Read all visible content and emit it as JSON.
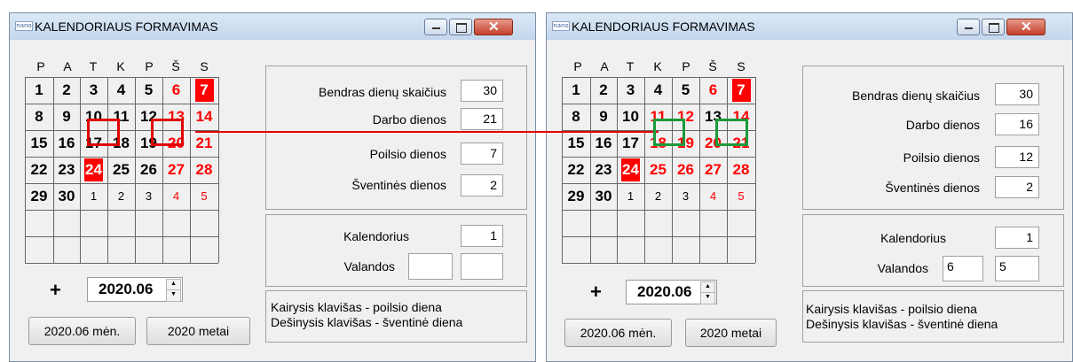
{
  "weekdays": [
    "P",
    "A",
    "T",
    "K",
    "P",
    "Š",
    "S"
  ],
  "left": {
    "title": "KALENDORIAUS FORMAVIMAS",
    "app_icon_text": "nano",
    "days": [
      {
        "t": "1",
        "s": "n"
      },
      {
        "t": "2",
        "s": "n"
      },
      {
        "t": "3",
        "s": "n"
      },
      {
        "t": "4",
        "s": "n"
      },
      {
        "t": "5",
        "s": "n"
      },
      {
        "t": "6",
        "s": "r"
      },
      {
        "t": "7",
        "s": "rb"
      },
      {
        "t": "8",
        "s": "n"
      },
      {
        "t": "9",
        "s": "n"
      },
      {
        "t": "10",
        "s": "n"
      },
      {
        "t": "11",
        "s": "n"
      },
      {
        "t": "12",
        "s": "n"
      },
      {
        "t": "13",
        "s": "r"
      },
      {
        "t": "14",
        "s": "r"
      },
      {
        "t": "15",
        "s": "n"
      },
      {
        "t": "16",
        "s": "n"
      },
      {
        "t": "17",
        "s": "n"
      },
      {
        "t": "18",
        "s": "n"
      },
      {
        "t": "19",
        "s": "n"
      },
      {
        "t": "20",
        "s": "r"
      },
      {
        "t": "21",
        "s": "r"
      },
      {
        "t": "22",
        "s": "n"
      },
      {
        "t": "23",
        "s": "n"
      },
      {
        "t": "24",
        "s": "rb"
      },
      {
        "t": "25",
        "s": "n"
      },
      {
        "t": "26",
        "s": "n"
      },
      {
        "t": "27",
        "s": "r"
      },
      {
        "t": "28",
        "s": "r"
      },
      {
        "t": "29",
        "s": "n"
      },
      {
        "t": "30",
        "s": "n"
      },
      {
        "t": "1",
        "s": "sm"
      },
      {
        "t": "2",
        "s": "sm"
      },
      {
        "t": "3",
        "s": "sm"
      },
      {
        "t": "4",
        "s": "smr"
      },
      {
        "t": "5",
        "s": "smr"
      }
    ],
    "stats": {
      "total_label": "Bendras dienų skaičius",
      "total": "30",
      "work_label": "Darbo dienos",
      "work": "21",
      "rest_label": "Poilsio dienos",
      "rest": "7",
      "holiday_label": "Šventinės dienos",
      "holiday": "2"
    },
    "calendar_label": "Kalendorius",
    "calendar_value": "1",
    "hours_label": "Valandos",
    "hours_a": "",
    "hours_b": "",
    "plus": "+",
    "spinner_value": "2020.06",
    "month_button": "2020.06 mėn.",
    "year_button": "2020 metai",
    "hint_1": "Kairysis klavišas - poilsio diena",
    "hint_2": "Dešinysis klavišas - šventinė diena"
  },
  "right": {
    "title": "KALENDORIAUS FORMAVIMAS",
    "app_icon_text": "nano",
    "days": [
      {
        "t": "1",
        "s": "n"
      },
      {
        "t": "2",
        "s": "n"
      },
      {
        "t": "3",
        "s": "n"
      },
      {
        "t": "4",
        "s": "n"
      },
      {
        "t": "5",
        "s": "n"
      },
      {
        "t": "6",
        "s": "r"
      },
      {
        "t": "7",
        "s": "rb"
      },
      {
        "t": "8",
        "s": "n"
      },
      {
        "t": "9",
        "s": "n"
      },
      {
        "t": "10",
        "s": "n"
      },
      {
        "t": "11",
        "s": "r"
      },
      {
        "t": "12",
        "s": "r"
      },
      {
        "t": "13",
        "s": "n"
      },
      {
        "t": "14",
        "s": "r"
      },
      {
        "t": "15",
        "s": "n"
      },
      {
        "t": "16",
        "s": "n"
      },
      {
        "t": "17",
        "s": "n"
      },
      {
        "t": "18",
        "s": "r"
      },
      {
        "t": "19",
        "s": "r"
      },
      {
        "t": "20",
        "s": "r"
      },
      {
        "t": "21",
        "s": "r"
      },
      {
        "t": "22",
        "s": "n"
      },
      {
        "t": "23",
        "s": "n"
      },
      {
        "t": "24",
        "s": "rb"
      },
      {
        "t": "25",
        "s": "r"
      },
      {
        "t": "26",
        "s": "r"
      },
      {
        "t": "27",
        "s": "r"
      },
      {
        "t": "28",
        "s": "r"
      },
      {
        "t": "29",
        "s": "n"
      },
      {
        "t": "30",
        "s": "n"
      },
      {
        "t": "1",
        "s": "sm"
      },
      {
        "t": "2",
        "s": "sm"
      },
      {
        "t": "3",
        "s": "sm"
      },
      {
        "t": "4",
        "s": "smr"
      },
      {
        "t": "5",
        "s": "smr"
      }
    ],
    "stats": {
      "total_label": "Bendras dienų skaičius",
      "total": "30",
      "work_label": "Darbo dienos",
      "work": "16",
      "rest_label": "Poilsio dienos",
      "rest": "12",
      "holiday_label": "Šventinės dienos",
      "holiday": "2"
    },
    "calendar_label": "Kalendorius",
    "calendar_value": "1",
    "hours_label": "Valandos",
    "hours_a": "6",
    "hours_b": "5",
    "plus": "+",
    "spinner_value": "2020.06",
    "month_button": "2020.06 mėn.",
    "year_button": "2020 metai",
    "hint_1": "Kairysis klavišas - poilsio diena",
    "hint_2": "Dešinysis klavišas - šventinė diena"
  },
  "colors": {
    "red": "#ff0000",
    "highlight_red": "#e00000",
    "highlight_green": "#1a9a3a"
  }
}
